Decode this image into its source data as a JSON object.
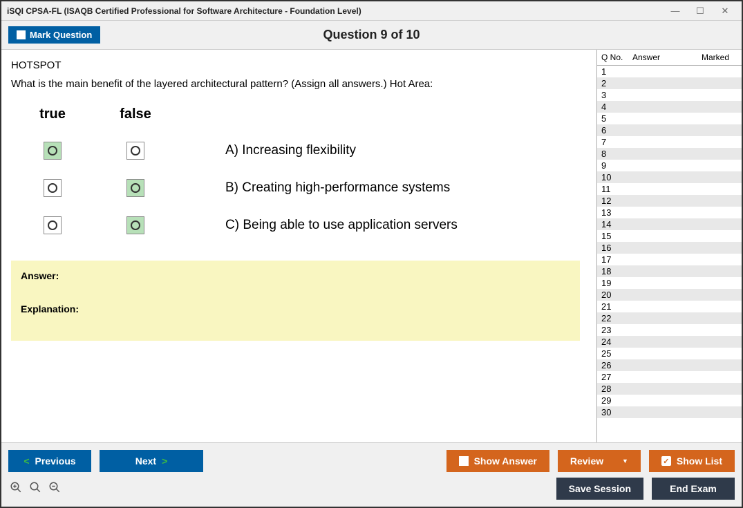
{
  "window": {
    "title": "iSQI CPSA-FL (ISAQB Certified Professional for Software Architecture - Foundation Level)"
  },
  "header": {
    "mark_label": "Mark Question",
    "question_title": "Question 9 of 10"
  },
  "question": {
    "type_label": "HOTSPOT",
    "prompt": "What is the main benefit of the layered architectural pattern? (Assign all answers.) Hot Area:",
    "col_true": "true",
    "col_false": "false",
    "options": [
      {
        "text": "A) Increasing flexibility",
        "true_selected": true,
        "false_selected": false
      },
      {
        "text": "B) Creating high-performance systems",
        "true_selected": false,
        "false_selected": true
      },
      {
        "text": "C) Being able to use application servers",
        "true_selected": false,
        "false_selected": true
      }
    ]
  },
  "answer_panel": {
    "answer_label": "Answer:",
    "explanation_label": "Explanation:"
  },
  "list": {
    "headers": {
      "qno": "Q No.",
      "answer": "Answer",
      "marked": "Marked"
    },
    "rows": [
      1,
      2,
      3,
      4,
      5,
      6,
      7,
      8,
      9,
      10,
      11,
      12,
      13,
      14,
      15,
      16,
      17,
      18,
      19,
      20,
      21,
      22,
      23,
      24,
      25,
      26,
      27,
      28,
      29,
      30
    ]
  },
  "footer": {
    "previous": "Previous",
    "next": "Next",
    "show_answer": "Show Answer",
    "review": "Review",
    "show_list": "Show List",
    "save_session": "Save Session",
    "end_exam": "End Exam"
  }
}
